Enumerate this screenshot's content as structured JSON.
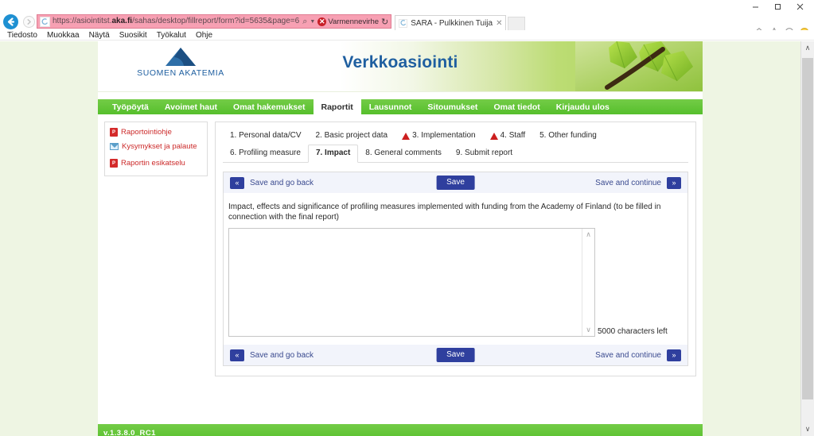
{
  "browser": {
    "window_controls": {
      "minimize": "–",
      "maximize": "❐",
      "close": "✕"
    },
    "back_label": "←",
    "forward_label": "→",
    "address": {
      "url_prefix": "https://asiointitst.",
      "url_domain": "aka.fi",
      "url_suffix": "/sahas/desktop/fillreport/form?id=5635&page=6",
      "full_url": "https://asiointitst.aka.fi/sahas/desktop/fillreport/form?id=5635&page=6",
      "search_icon": "⌕",
      "dropdown_icon": "▼",
      "certificate_warning": "Varmennevirhe",
      "certificate_badge": "✕",
      "refresh_icon": "↻"
    },
    "tab": {
      "title": "SARA - Pulkkinen Tuija",
      "close_icon": "✕"
    },
    "command_icons": [
      "home-icon",
      "favorites-star-icon",
      "settings-gear-icon",
      "smiley-feedback-icon"
    ],
    "menu": [
      "Tiedosto",
      "Muokkaa",
      "Näytä",
      "Suosikit",
      "Työkalut",
      "Ohje"
    ]
  },
  "banner": {
    "logo_text": "SUOMEN AKATEMIA",
    "title": "Verkkoasiointi"
  },
  "main_nav": {
    "items": [
      {
        "label": "Työpöytä",
        "active": false
      },
      {
        "label": "Avoimet haut",
        "active": false
      },
      {
        "label": "Omat hakemukset",
        "active": false
      },
      {
        "label": "Raportit",
        "active": true
      },
      {
        "label": "Lausunnot",
        "active": false
      },
      {
        "label": "Sitoumukset",
        "active": false
      },
      {
        "label": "Omat tiedot",
        "active": false
      },
      {
        "label": "Kirjaudu ulos",
        "active": false
      }
    ]
  },
  "sidebar": {
    "items": [
      {
        "label": "Raportointiohje",
        "icon": "pdf-icon"
      },
      {
        "label": "Kysymykset ja palaute",
        "icon": "mail-icon"
      },
      {
        "label": "Raportin esikatselu",
        "icon": "pdf-icon"
      }
    ]
  },
  "steps": [
    {
      "label": "1. Personal data/CV",
      "warning": false,
      "active": false
    },
    {
      "label": "2. Basic project data",
      "warning": false,
      "active": false
    },
    {
      "label": "3. Implementation",
      "warning": true,
      "active": false
    },
    {
      "label": "4. Staff",
      "warning": true,
      "active": false
    },
    {
      "label": "5. Other funding",
      "warning": false,
      "active": false
    },
    {
      "label": "6. Profiling measure",
      "warning": false,
      "active": false
    },
    {
      "label": "7. Impact",
      "warning": false,
      "active": true
    },
    {
      "label": "8. General comments",
      "warning": false,
      "active": false
    },
    {
      "label": "9. Submit report",
      "warning": false,
      "active": false
    }
  ],
  "toolbar": {
    "back_arrow": "«",
    "back_label": "Save and go back",
    "save_label": "Save",
    "continue_label": "Save and continue",
    "forward_arrow": "»"
  },
  "form": {
    "field_label": "Impact, effects and significance of profiling measures implemented with funding from the Academy of Finland (to be filled in connection with the final report)",
    "textarea_value": "",
    "characters_left": "5000 characters left",
    "scroll_up_icon": "∧",
    "scroll_down_icon": "∨"
  },
  "footer": {
    "version": "v.1.3.8.0_RC1"
  },
  "page_scrollbar": {
    "up_icon": "∧",
    "down_icon": "∨"
  },
  "colors": {
    "brand_green": "#56bf2c",
    "brand_blue": "#1f5fa0",
    "button_blue": "#2f3f9e",
    "warning_red": "#cc1f1f",
    "address_bar_pink": "#f7a0b3"
  }
}
